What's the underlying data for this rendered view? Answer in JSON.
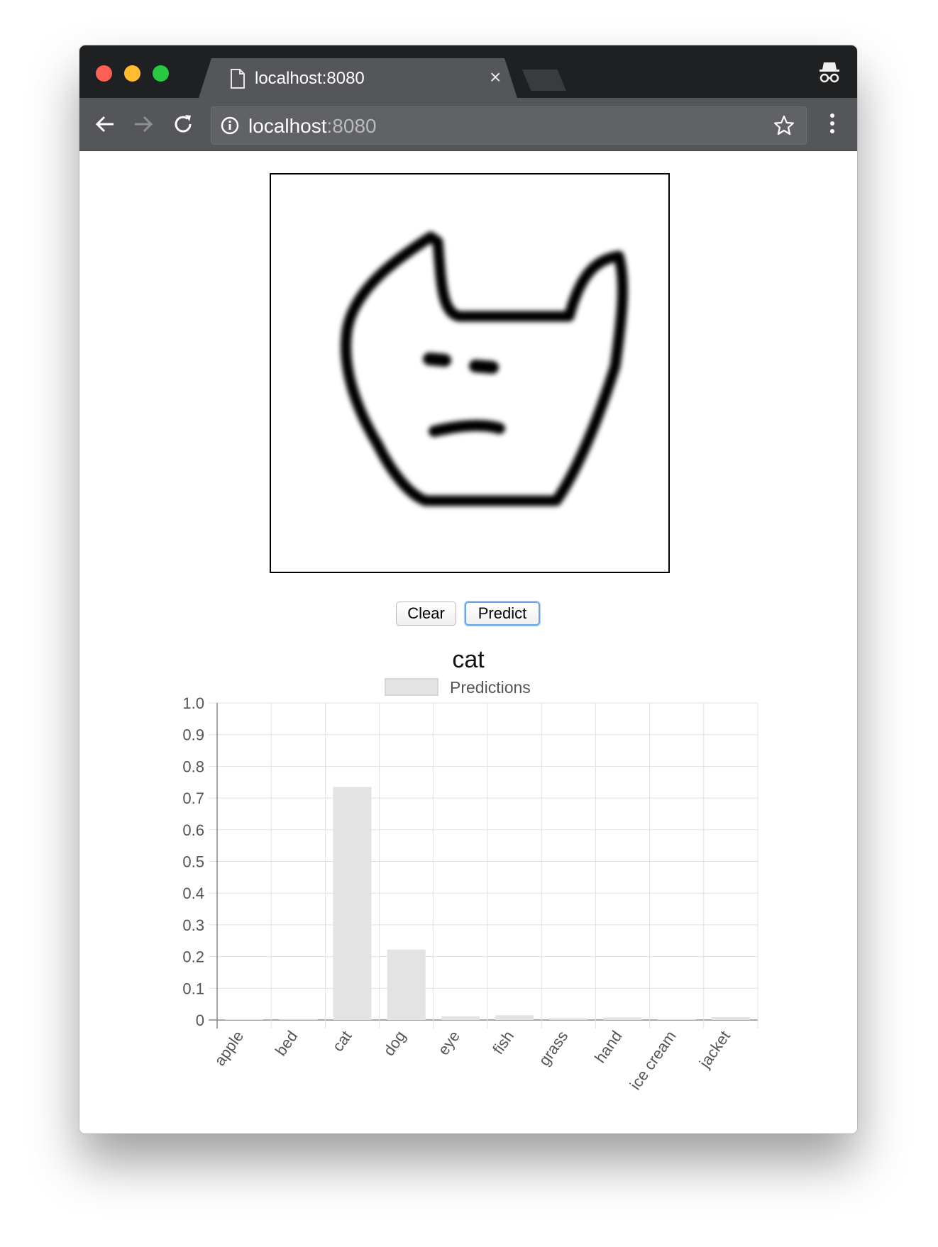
{
  "browser": {
    "tab_title": "localhost:8080",
    "close_glyph": "×",
    "url_host": "localhost",
    "url_port": ":8080"
  },
  "app": {
    "clear_label": "Clear",
    "predict_label": "Predict",
    "prediction": "cat"
  },
  "colors": {
    "bar_fill": "#e3e3e3",
    "bar_stroke": "#d6d6d6",
    "grid": "#e1e1e1",
    "axis": "#8a8a8a",
    "text": "#555555"
  },
  "chart_data": {
    "type": "bar",
    "categories": [
      "apple",
      "bed",
      "cat",
      "dog",
      "eye",
      "fish",
      "grass",
      "hand",
      "ice cream",
      "jacket"
    ],
    "series": [
      {
        "name": "Predictions",
        "values": [
          0.002,
          0.001,
          0.735,
          0.222,
          0.012,
          0.015,
          0.006,
          0.008,
          0.002,
          0.009
        ]
      }
    ],
    "yticks": [
      "0",
      "0.1",
      "0.2",
      "0.3",
      "0.4",
      "0.5",
      "0.6",
      "0.7",
      "0.8",
      "0.9",
      "1.0"
    ],
    "ylim": [
      0,
      1
    ],
    "grid": true,
    "legend": "top-center",
    "xlabel_rotation": "-55deg"
  }
}
